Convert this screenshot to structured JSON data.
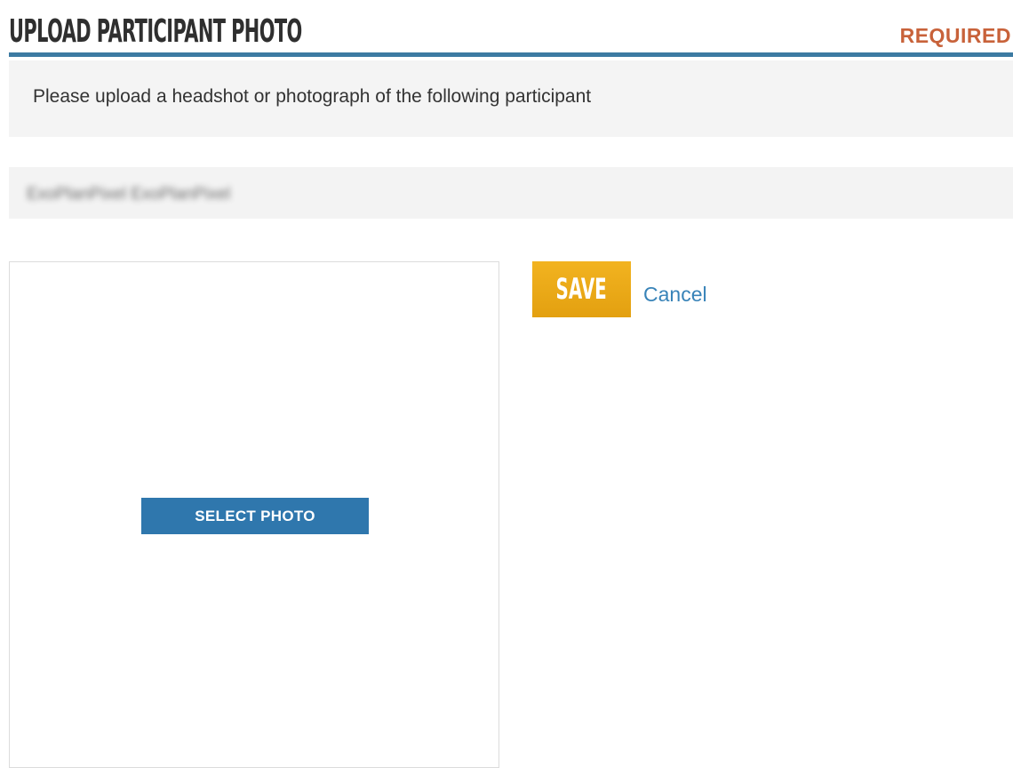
{
  "header": {
    "title": "UPLOAD PARTICIPANT PHOTO",
    "required_label": "REQUIRED"
  },
  "instructions": {
    "text": "Please upload a headshot or photograph of the following participant"
  },
  "participant": {
    "name": "ExoPlanPixel ExoPlanPixel"
  },
  "photo": {
    "select_label": "SELECT PHOTO"
  },
  "actions": {
    "save_label": "SAVE",
    "cancel_label": "Cancel"
  },
  "colors": {
    "header_rule": "#3c7aa2",
    "required": "#c8623a",
    "select_button": "#2f77ad",
    "save_button": "#eaa818",
    "cancel_link": "#3883b8"
  }
}
